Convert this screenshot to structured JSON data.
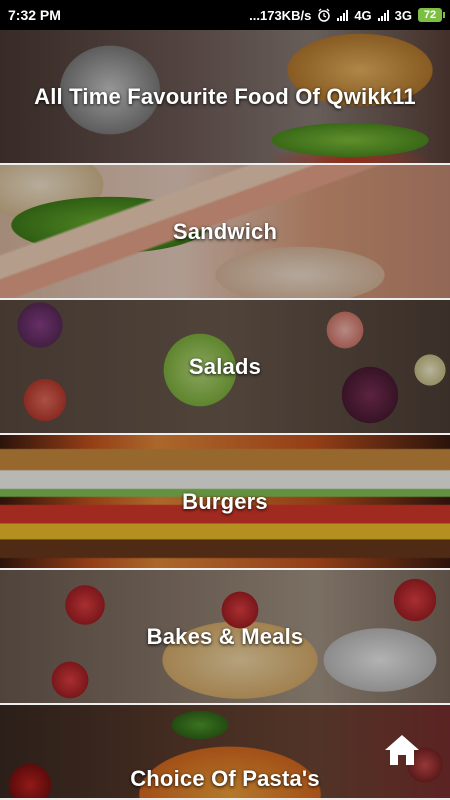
{
  "status_bar": {
    "time": "7:32 PM",
    "network_speed": "...173KB/s",
    "network_type_1": "4G",
    "network_type_2": "3G",
    "battery": "72",
    "alarm_icon": "alarm-clock-icon",
    "signal_icon": "signal-bars-icon"
  },
  "categories": [
    {
      "label": "All Time Favourite Food Of Qwikk11"
    },
    {
      "label": "Sandwich"
    },
    {
      "label": "Salads"
    },
    {
      "label": "Burgers"
    },
    {
      "label": "Bakes & Meals"
    },
    {
      "label": "Choice Of Pasta's"
    }
  ],
  "fab": {
    "icon": "home-icon"
  },
  "colors": {
    "battery": "#7cc043",
    "text": "#ffffff",
    "divider": "#eeeeee"
  }
}
